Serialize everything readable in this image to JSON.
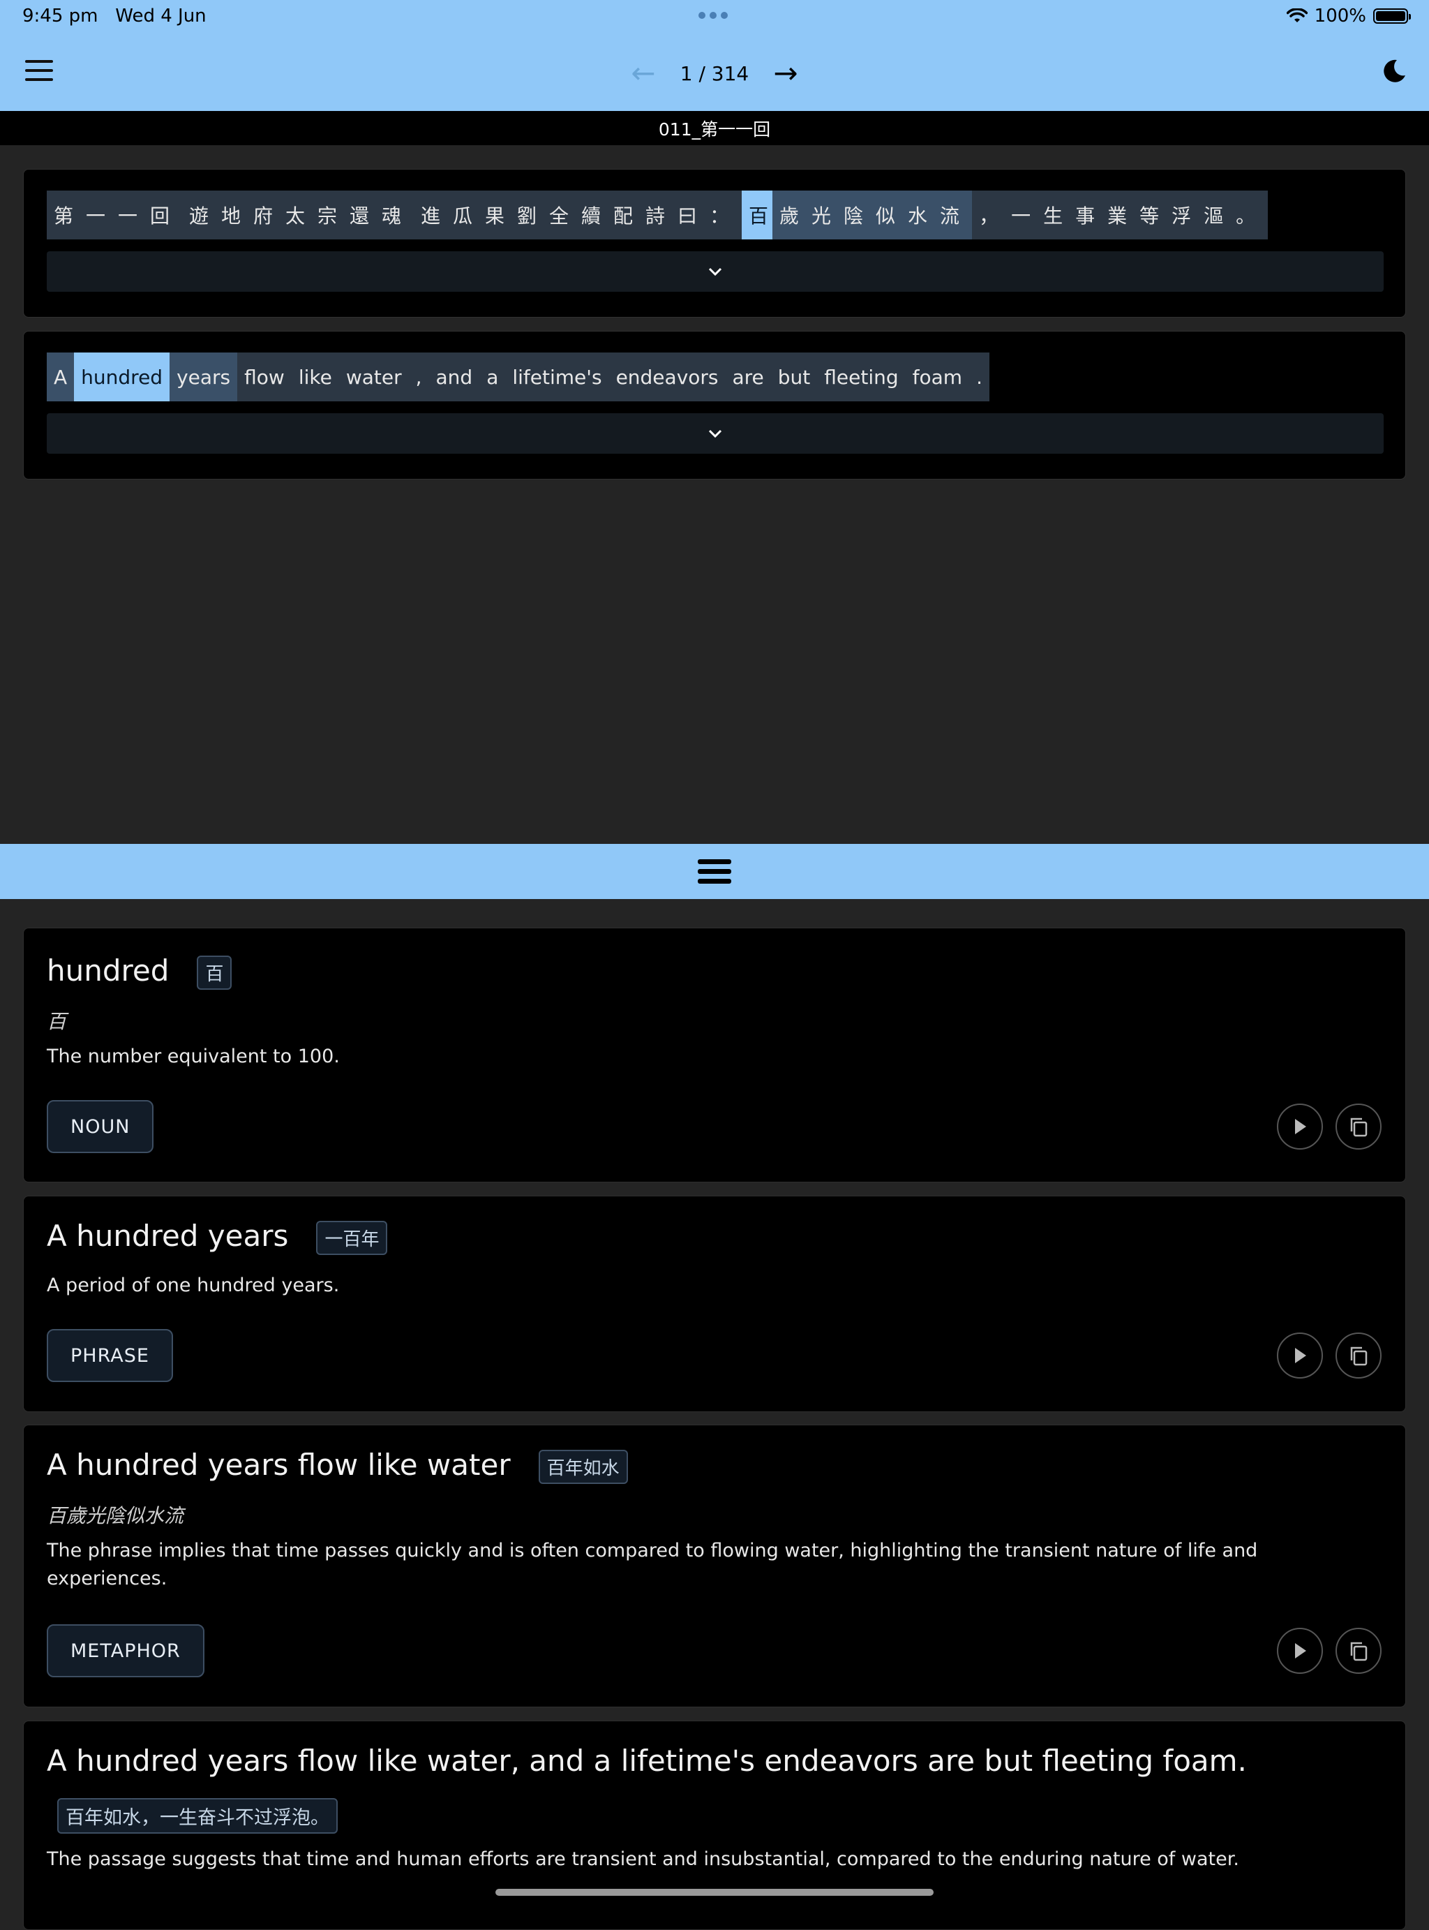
{
  "status_bar": {
    "time": "9:45 pm",
    "date": "Wed 4 Jun",
    "battery": "100%"
  },
  "toolbar": {
    "page_indicator": "1 / 314"
  },
  "chapter": {
    "title": "011_第一一回"
  },
  "source_tokens": [
    "第一一回",
    "遊地府太宗還魂",
    "進瓜果劉全續配詩曰：",
    "百",
    "歲光陰似水流",
    "，一生事業等浮漚。"
  ],
  "translation_tokens": [
    "A",
    "hundred",
    "years",
    "flow",
    "like",
    "water",
    ",",
    "and",
    "a",
    "lifetime's",
    "endeavors",
    "are",
    "but",
    "fleeting",
    "foam",
    "."
  ],
  "cards": [
    {
      "title": "hundred",
      "tag": "百",
      "original": "百",
      "definition": "The number equivalent to 100.",
      "pos": "NOUN"
    },
    {
      "title": "A hundred years",
      "tag": "一百年",
      "definition": "A period of one hundred years.",
      "pos": "PHRASE"
    },
    {
      "title": "A hundred years flow like water",
      "tag": "百年如水",
      "original": "百歲光陰似水流",
      "definition": "The phrase implies that time passes quickly and is often compared to flowing water, highlighting the transient nature of life and experiences.",
      "pos": "METAPHOR"
    },
    {
      "title": "A hundred years flow like water, and a lifetime's endeavors are but fleeting foam.",
      "tag": "百年如水，一生奋斗不过浮泡。",
      "definition": "The passage suggests that time and human efforts are transient and insubstantial, compared to the enduring nature of water."
    }
  ],
  "colors": {
    "accent": "#90c8f8",
    "background": "#242424",
    "card": "#000000",
    "token_bg": "#2c3744",
    "token_phrase": "#3a5068"
  },
  "icons": [
    "menu-icon",
    "arrow-left-icon",
    "arrow-right-icon",
    "moon-icon",
    "wifi-icon",
    "battery-icon",
    "chevron-down-icon",
    "drag-handle-icon",
    "play-icon",
    "copy-icon"
  ]
}
